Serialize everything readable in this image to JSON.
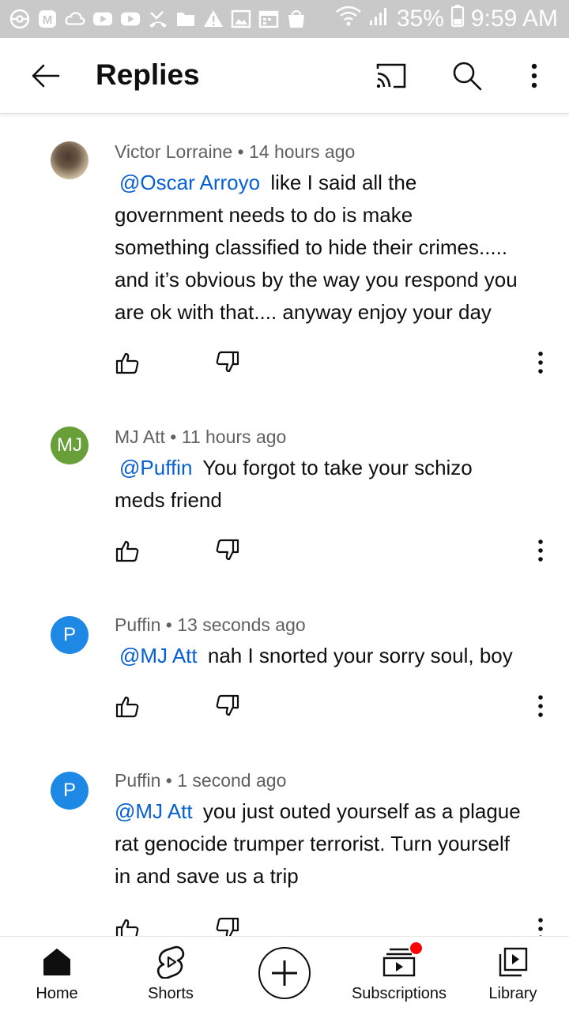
{
  "status_bar": {
    "battery": "35%",
    "time": "9:59 AM",
    "left_icons": [
      "pokeball-icon",
      "maps-icon",
      "cloud-icon",
      "youtube-icon",
      "youtube-icon",
      "missed-call-icon",
      "folder-icon",
      "warning-icon",
      "image-icon",
      "calendar-icon",
      "shopping-bag-icon"
    ],
    "right_icons": [
      "wifi-icon",
      "signal-icon",
      "battery-icon"
    ]
  },
  "header": {
    "title": "Replies",
    "icons": [
      "back-arrow-icon",
      "cast-icon",
      "search-icon",
      "more-vert-icon"
    ]
  },
  "comments": [
    {
      "author": "Victor Lorraine",
      "time": "14 hours ago",
      "avatar": "photo",
      "mention": "@Oscar Arroyo",
      "text_lines": [
        "like I said all the",
        "government needs to do is make",
        "something classified to hide their crimes.....",
        "and it’s obvious by the way you respond you",
        "are ok with that.... anyway enjoy your day"
      ]
    },
    {
      "author": "MJ Att",
      "time": "11 hours ago",
      "avatar_initials": "MJ",
      "avatar_color": "#689f38",
      "mention": "@Puffin",
      "text_lines": [
        "You forgot to take your schizo",
        "meds friend"
      ]
    },
    {
      "author": "Puffin",
      "time": "13 seconds ago",
      "avatar_initials": "P",
      "avatar_color": "#1e88e5",
      "mention": "@MJ Att",
      "text_lines": [
        "nah I snorted your sorry soul, boy"
      ]
    },
    {
      "author": "Puffin",
      "time": "1 second ago",
      "avatar_initials": "P",
      "avatar_color": "#1e88e5",
      "mention": "@MJ Att",
      "text_lines": [
        "you just outed yourself as a plague",
        "rat genocide trumper terrorist. Turn yourself",
        "in and save us a trip"
      ]
    }
  ],
  "separator": "•",
  "bottom_nav": {
    "home": "Home",
    "shorts": "Shorts",
    "subscriptions": "Subscriptions",
    "library": "Library"
  },
  "colors": {
    "status_bar_bg": "#c9c9c9",
    "mention": "#065fd4",
    "meta_text": "#606060",
    "notification_badge": "#ff0000"
  }
}
